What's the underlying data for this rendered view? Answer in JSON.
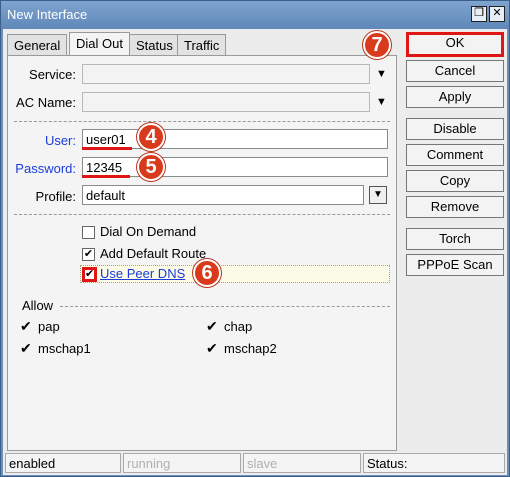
{
  "window": {
    "title": "New Interface",
    "restore_label": "❐",
    "close_label": "✕"
  },
  "tabs": [
    {
      "label": "General"
    },
    {
      "label": "Dial Out"
    },
    {
      "label": "Status"
    },
    {
      "label": "Traffic"
    }
  ],
  "fields": {
    "service": {
      "label": "Service:",
      "value": ""
    },
    "ac_name": {
      "label": "AC Name:",
      "value": ""
    },
    "user": {
      "label": "User:",
      "value": "user01"
    },
    "password": {
      "label": "Password:",
      "value": "12345"
    },
    "profile": {
      "label": "Profile:",
      "value": "default"
    }
  },
  "options": {
    "dial_on_demand": {
      "label": "Dial On Demand",
      "checked": false
    },
    "add_default_route": {
      "label": "Add Default Route",
      "checked": true
    },
    "use_peer_dns": {
      "label": "Use Peer DNS",
      "checked": true
    }
  },
  "allow": {
    "title": "Allow",
    "items": [
      {
        "label": "pap",
        "checked": true
      },
      {
        "label": "chap",
        "checked": true
      },
      {
        "label": "mschap1",
        "checked": true
      },
      {
        "label": "mschap2",
        "checked": true
      }
    ]
  },
  "buttons": {
    "ok": "OK",
    "cancel": "Cancel",
    "apply": "Apply",
    "disable": "Disable",
    "comment": "Comment",
    "copy": "Copy",
    "remove": "Remove",
    "torch": "Torch",
    "pppoe_scan": "PPPoE Scan"
  },
  "status": {
    "enabled": "enabled",
    "running": "running",
    "slave": "slave",
    "status_label": "Status:"
  },
  "annotations": {
    "four": "4",
    "five": "5",
    "six": "6",
    "seven": "7"
  },
  "glyphs": {
    "check": "✔",
    "dropdown": "▼",
    "down": "▼"
  },
  "colors": {
    "highlight": "#e01515",
    "link": "#1a3cdc",
    "badge": "#d93a1c"
  }
}
